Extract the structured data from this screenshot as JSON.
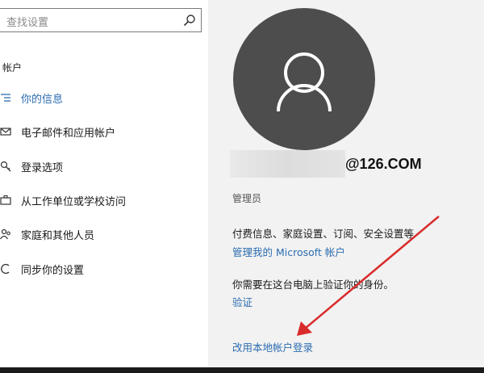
{
  "search": {
    "placeholder": "查找设置"
  },
  "sidebar": {
    "section_title": "帐户",
    "items": [
      {
        "label": "你的信息",
        "icon": "person-card-icon"
      },
      {
        "label": "电子邮件和应用帐户",
        "icon": "mail-icon"
      },
      {
        "label": "登录选项",
        "icon": "key-icon"
      },
      {
        "label": "从工作单位或学校访问",
        "icon": "briefcase-icon"
      },
      {
        "label": "家庭和其他人员",
        "icon": "people-icon"
      },
      {
        "label": "同步你的设置",
        "icon": "sync-icon"
      }
    ]
  },
  "account": {
    "email_suffix": "@126.COM",
    "role": "管理员",
    "description": "付费信息、家庭设置、订阅、安全设置等",
    "manage_link": "管理我的 Microsoft 帐户",
    "verify_message": "你需要在这台电脑上验证你的身份。",
    "verify_link": "验证",
    "switch_local_link": "改用本地帐户登录"
  },
  "colors": {
    "accent": "#2b6cb0",
    "annotation_arrow": "#d92b2b",
    "avatar_bg": "#4d4d4d"
  }
}
